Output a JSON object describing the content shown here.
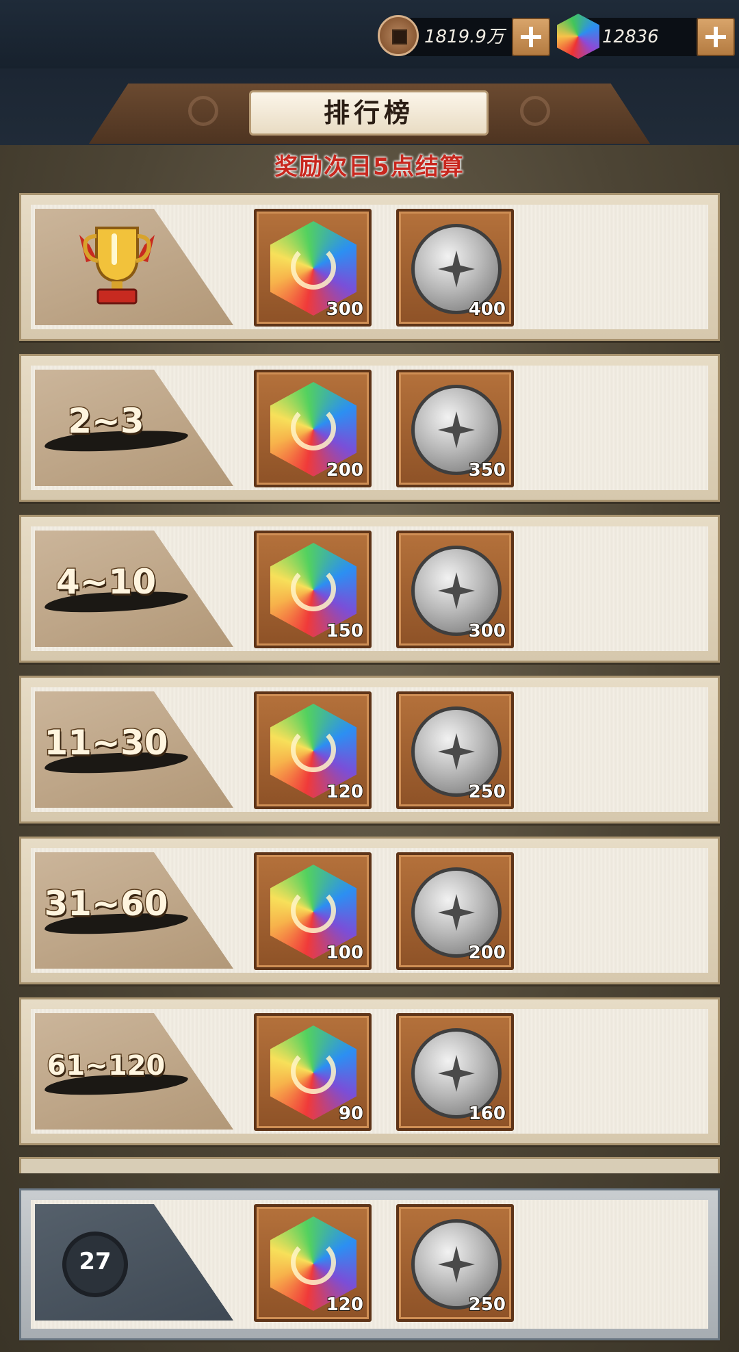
{
  "topbar": {
    "copper": {
      "icon": "copper-coin-icon",
      "value": "1819.9万"
    },
    "gem": {
      "icon": "rainbow-gem-icon",
      "value": "12836"
    }
  },
  "header": {
    "title": "排行榜",
    "subtitle": "奖励次日5点结算"
  },
  "rewards": [
    {
      "rank": "",
      "rank_icon": "trophy-icon",
      "gem": "300",
      "coin": "400"
    },
    {
      "rank": "2~3",
      "gem": "200",
      "coin": "350"
    },
    {
      "rank": "4~10",
      "gem": "150",
      "coin": "300"
    },
    {
      "rank": "11~30",
      "gem": "120",
      "coin": "250"
    },
    {
      "rank": "31~60",
      "gem": "100",
      "coin": "200"
    },
    {
      "rank": "61~120",
      "gem": "90",
      "coin": "160"
    }
  ],
  "my_reward": {
    "rank": "27",
    "gem": "120",
    "coin": "250"
  },
  "colors": {
    "subtitle": "#c8271e",
    "item_bg": "#a9652f",
    "panel": "#e7dcc6"
  }
}
